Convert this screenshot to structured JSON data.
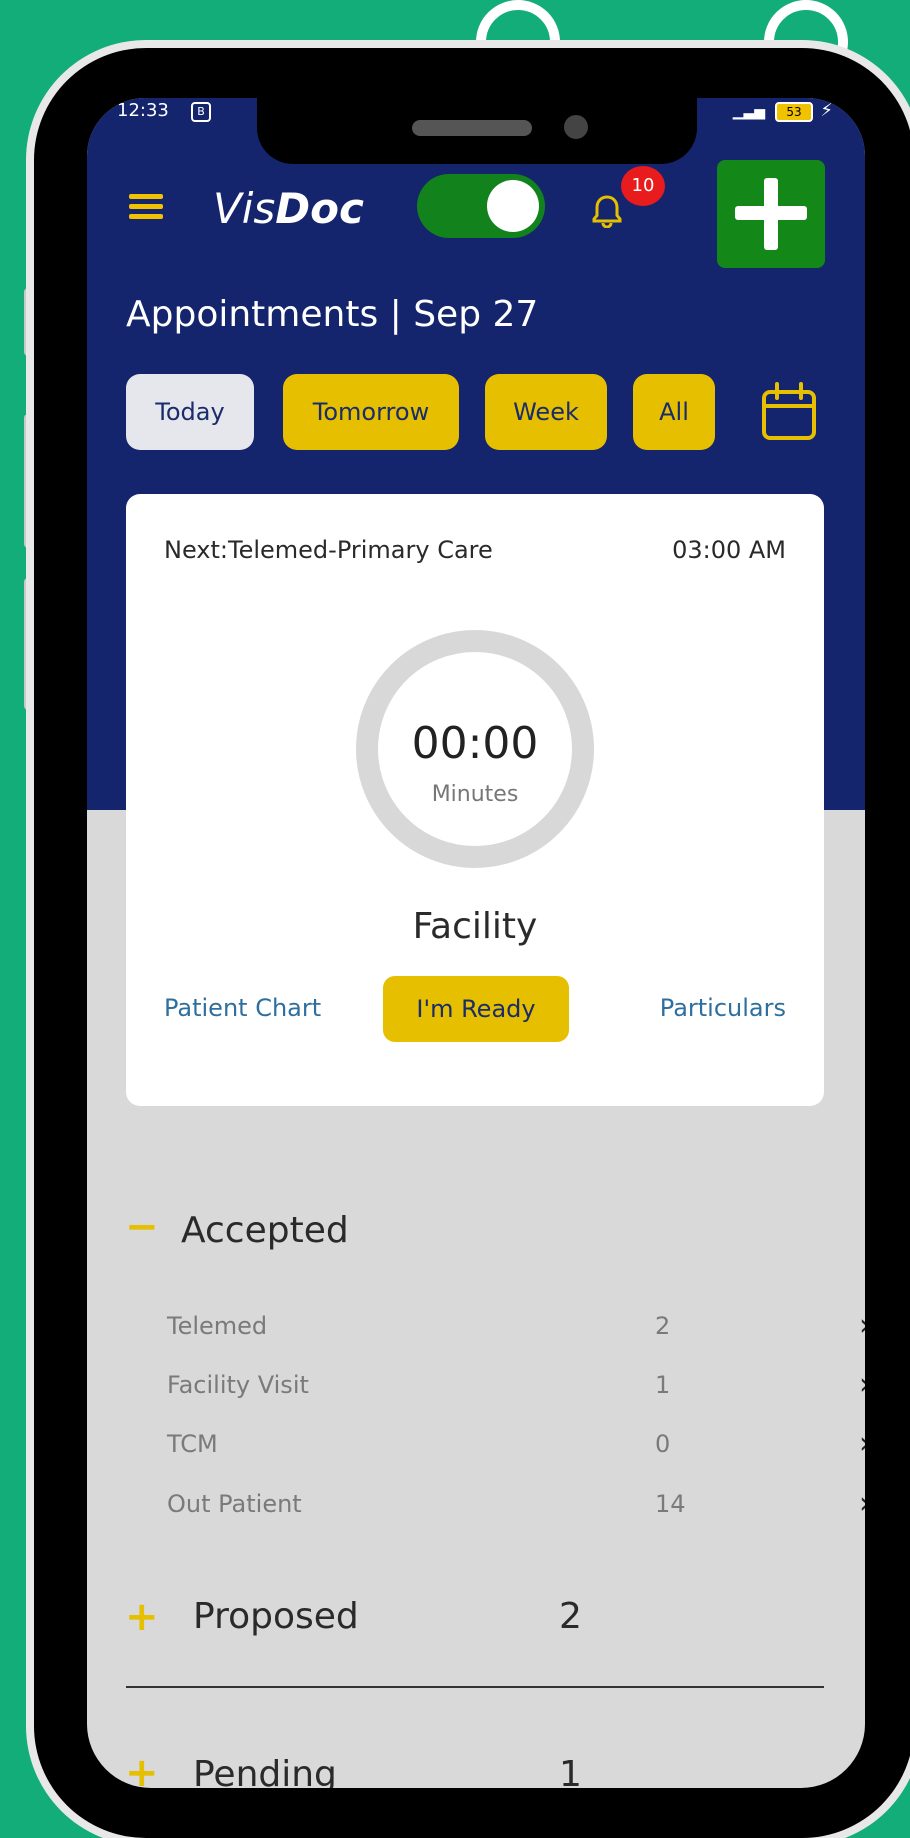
{
  "status_bar": {
    "time": "12:33",
    "indicator": "B",
    "battery": "53"
  },
  "app": {
    "title_part1": "Vis",
    "title_part2": "Doc",
    "notification_count": "10"
  },
  "appointments": {
    "title": "Appointments | Sep 27"
  },
  "tabs": [
    "Today",
    "Tomorrow",
    "Week",
    "All"
  ],
  "next_card": {
    "label": "Next:Telemed-Primary Care",
    "time": "03:00 AM",
    "timer": "00:00",
    "timer_unit": "Minutes",
    "location": "Facility",
    "patient_chart": "Patient Chart",
    "ready_button": "I'm Ready",
    "particulars": "Particulars"
  },
  "accepted": {
    "toggle": "−",
    "title": "Accepted",
    "items": [
      {
        "label": "Telemed",
        "count": "2"
      },
      {
        "label": "Facility Visit",
        "count": "1"
      },
      {
        "label": "TCM",
        "count": "0"
      },
      {
        "label": "Out Patient",
        "count": "14"
      }
    ]
  },
  "proposed": {
    "toggle": "+",
    "title": "Proposed",
    "count": "2"
  },
  "pending": {
    "toggle": "+",
    "title": "Pending",
    "count": "1"
  },
  "colors": {
    "header": "#14246d",
    "accent": "#e5bf00",
    "green": "#12821d",
    "background": "#12ad78"
  }
}
